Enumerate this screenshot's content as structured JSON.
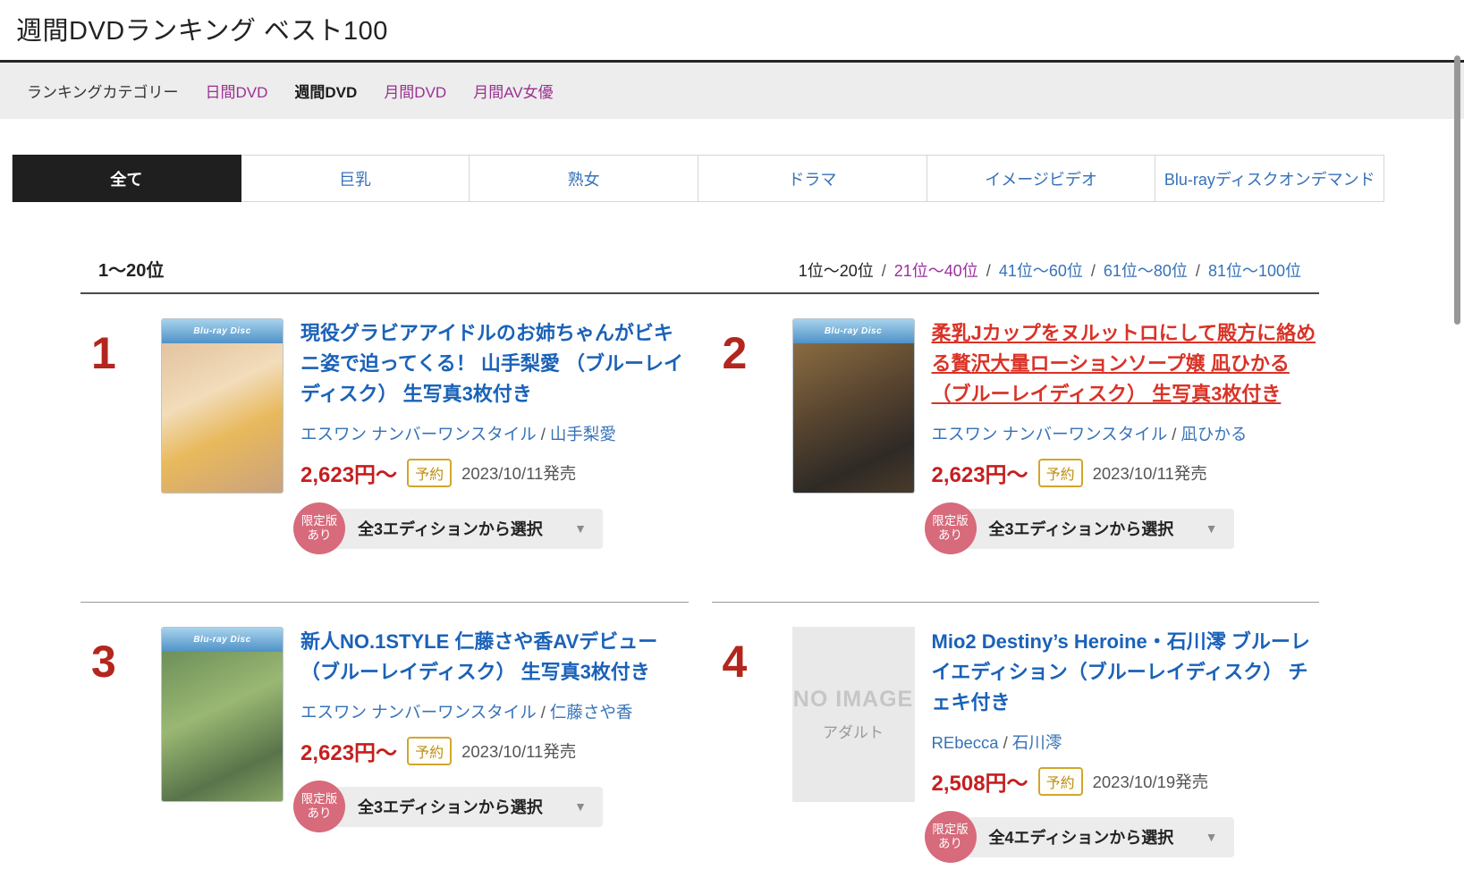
{
  "page": {
    "title": "週間DVDランキング ベスト100"
  },
  "category_nav": {
    "label": "ランキングカテゴリー",
    "items": [
      {
        "label": "日間DVD"
      },
      {
        "label": "週間DVD"
      },
      {
        "label": "月間DVD"
      },
      {
        "label": "月間AV女優"
      }
    ]
  },
  "genre_tabs": [
    {
      "label": "全て",
      "active": true
    },
    {
      "label": "巨乳"
    },
    {
      "label": "熟女"
    },
    {
      "label": "ドラマ"
    },
    {
      "label": "イメージビデオ"
    },
    {
      "label": "Blu-rayディスクオンデマンド"
    }
  ],
  "range_nav": {
    "heading": "1〜20位",
    "separator": "/",
    "links": [
      {
        "label": "1位〜20位",
        "state": "current"
      },
      {
        "label": "21位〜40位",
        "state": "visited"
      },
      {
        "label": "41位〜60位",
        "state": "link"
      },
      {
        "label": "61位〜80位",
        "state": "link"
      },
      {
        "label": "81位〜100位",
        "state": "link"
      }
    ]
  },
  "cover_logo": "Blu-ray Disc",
  "items": [
    {
      "rank": "1",
      "title": "現役グラビアアイドルのお姉ちゃんがビキニ姿で迫ってくる！ 山手梨愛 （ブルーレイディスク） 生写真3枚付き",
      "maker": "エスワン ナンバーワンスタイル",
      "separator": "/",
      "performer": "山手梨愛",
      "price": "2,623円〜",
      "preorder": "予約",
      "release": "2023/10/11発売",
      "limited_line1": "限定版",
      "limited_line2": "あり",
      "edition_select": "全3エディションから選択",
      "dropdown_arrow": "▼"
    },
    {
      "rank": "2",
      "title": "柔乳Jカップをヌルットロにして殿方に絡める贅沢大量ローションソープ嬢 凪ひかる （ブルーレイディスク） 生写真3枚付き",
      "maker": "エスワン ナンバーワンスタイル",
      "separator": "/",
      "performer": "凪ひかる",
      "price": "2,623円〜",
      "preorder": "予約",
      "release": "2023/10/11発売",
      "limited_line1": "限定版",
      "limited_line2": "あり",
      "edition_select": "全3エディションから選択",
      "dropdown_arrow": "▼"
    },
    {
      "rank": "3",
      "title": "新人NO.1STYLE 仁藤さや香AVデビュー （ブルーレイディスク） 生写真3枚付き",
      "maker": "エスワン ナンバーワンスタイル",
      "separator": "/",
      "performer": "仁藤さや香",
      "price": "2,623円〜",
      "preorder": "予約",
      "release": "2023/10/11発売",
      "limited_line1": "限定版",
      "limited_line2": "あり",
      "edition_select": "全3エディションから選択",
      "dropdown_arrow": "▼"
    },
    {
      "rank": "4",
      "title": "Mio2 Destiny’s Heroine・石川澪 ブルーレイエディション（ブルーレイディスク） チェキ付き",
      "maker": "REbecca",
      "separator": "/",
      "performer": "石川澪",
      "price": "2,508円〜",
      "preorder": "予約",
      "release": "2023/10/19発売",
      "limited_line1": "限定版",
      "limited_line2": "あり",
      "edition_select": "全4エディションから選択",
      "dropdown_arrow": "▼",
      "no_image_line1": "NO IMAGE",
      "no_image_line2": "アダルト"
    }
  ],
  "colors": {
    "rank_red": "#b3261e",
    "price_red": "#c51f1f",
    "title_blue": "#1a62b8",
    "title_visited_red": "#d93327",
    "link_blue": "#3672b9",
    "visited_purple": "#9b3091",
    "limited_badge_pink": "#d76a7b",
    "preorder_gold": "#bd8f14",
    "tab_active_bg": "#1f1f1f",
    "category_bar_bg": "#ededed"
  }
}
